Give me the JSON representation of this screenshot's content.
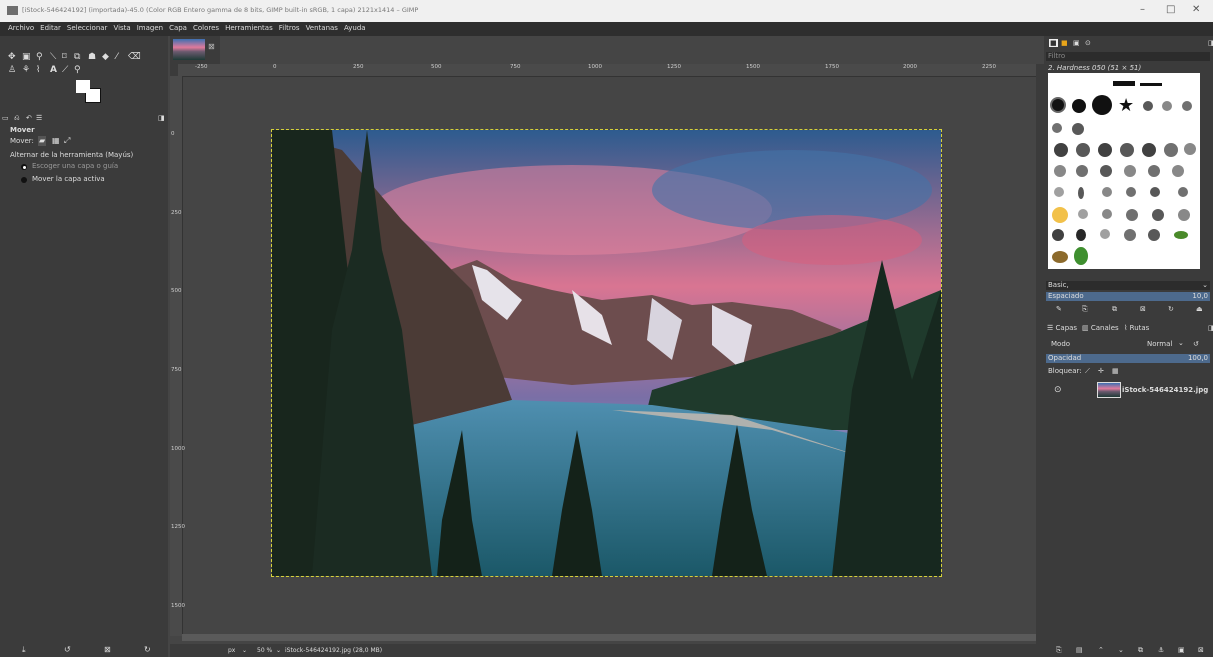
{
  "window": {
    "title": "[iStock-546424192] (importada)-45.0 (Color RGB Entero gamma de 8 bits, GIMP built-in sRGB, 1 capa) 2121x1414 – GIMP",
    "controls": [
      "–",
      "□",
      "✕"
    ]
  },
  "menu": [
    "Archivo",
    "Editar",
    "Seleccionar",
    "Vista",
    "Imagen",
    "Capa",
    "Colores",
    "Herramientas",
    "Filtros",
    "Ventanas",
    "Ayuda"
  ],
  "tool_options": {
    "title": "Mover",
    "move_label": "Mover:",
    "toggle_label": "Alternar de la herramienta  (Mayús)",
    "option_1": "Escoger una capa o guía",
    "option_2": "Mover la capa activa"
  },
  "rulers": {
    "h_ticks": [
      "-250",
      "0",
      "250",
      "500",
      "750",
      "1000",
      "1250",
      "1500",
      "1750",
      "2000",
      "2250"
    ],
    "v_ticks": [
      "0",
      "250",
      "500",
      "750",
      "1000",
      "1250",
      "1500"
    ]
  },
  "status": {
    "unit": "px",
    "zoom": "50 %",
    "file_info": "iStock-546424192.jpg (28,0 MB)"
  },
  "brushes": {
    "filter_placeholder": "Filtro",
    "current": "2. Hardness 050 (51 × 51)",
    "preset": "Basic,",
    "spacing_label": "Espaciado",
    "spacing_value": "10,0"
  },
  "layers": {
    "tabs": [
      "Capas",
      "Canales",
      "Rutas"
    ],
    "mode_label": "Modo",
    "mode_value": "Normal",
    "opacity_label": "Opacidad",
    "opacity_value": "100,0",
    "lock_label": "Bloquear:",
    "layer_name": "iStock-546424192.jpg"
  },
  "colors": {
    "accent": "#d6d23a",
    "panel": "#3b3b3b",
    "canvas": "#454545"
  }
}
